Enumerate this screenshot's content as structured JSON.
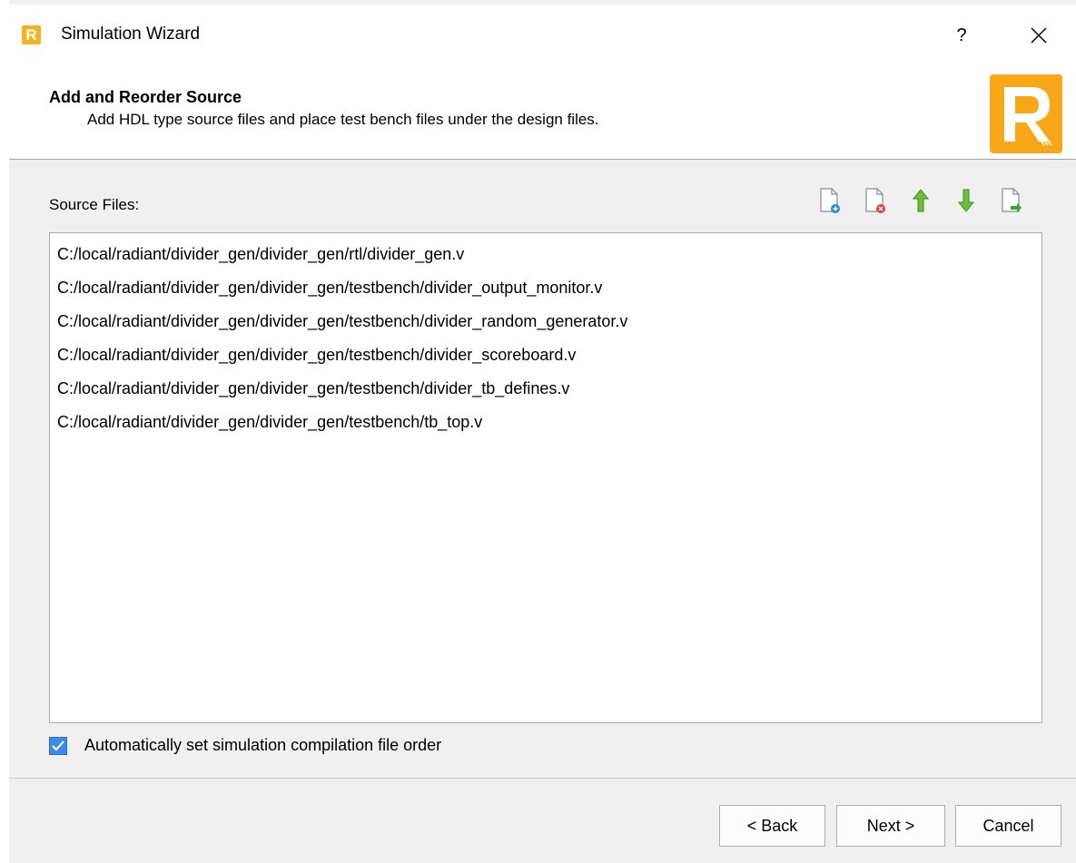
{
  "window": {
    "title": "Simulation Wizard",
    "help_label": "?",
    "app_logo_letter": "R"
  },
  "header": {
    "title": "Add and Reorder Source",
    "subtitle": "Add HDL type source files and place test bench files under the design files."
  },
  "source": {
    "label": "Source Files:",
    "files": [
      "C:/local/radiant/divider_gen/divider_gen/rtl/divider_gen.v",
      "C:/local/radiant/divider_gen/divider_gen/testbench/divider_output_monitor.v",
      "C:/local/radiant/divider_gen/divider_gen/testbench/divider_random_generator.v",
      "C:/local/radiant/divider_gen/divider_gen/testbench/divider_scoreboard.v",
      "C:/local/radiant/divider_gen/divider_gen/testbench/divider_tb_defines.v",
      "C:/local/radiant/divider_gen/divider_gen/testbench/tb_top.v"
    ],
    "toolbar_icons": [
      "add-file-icon",
      "remove-file-icon",
      "move-up-icon",
      "move-down-icon",
      "import-file-icon"
    ]
  },
  "options": {
    "auto_order_label": "Automatically set simulation compilation file order",
    "auto_order_checked": true
  },
  "buttons": {
    "back": "< Back",
    "next": "Next >",
    "cancel": "Cancel"
  },
  "colors": {
    "brand_orange": "#f8a718",
    "checkbox_blue": "#3c8be8",
    "arrow_green": "#6bbf3c"
  }
}
